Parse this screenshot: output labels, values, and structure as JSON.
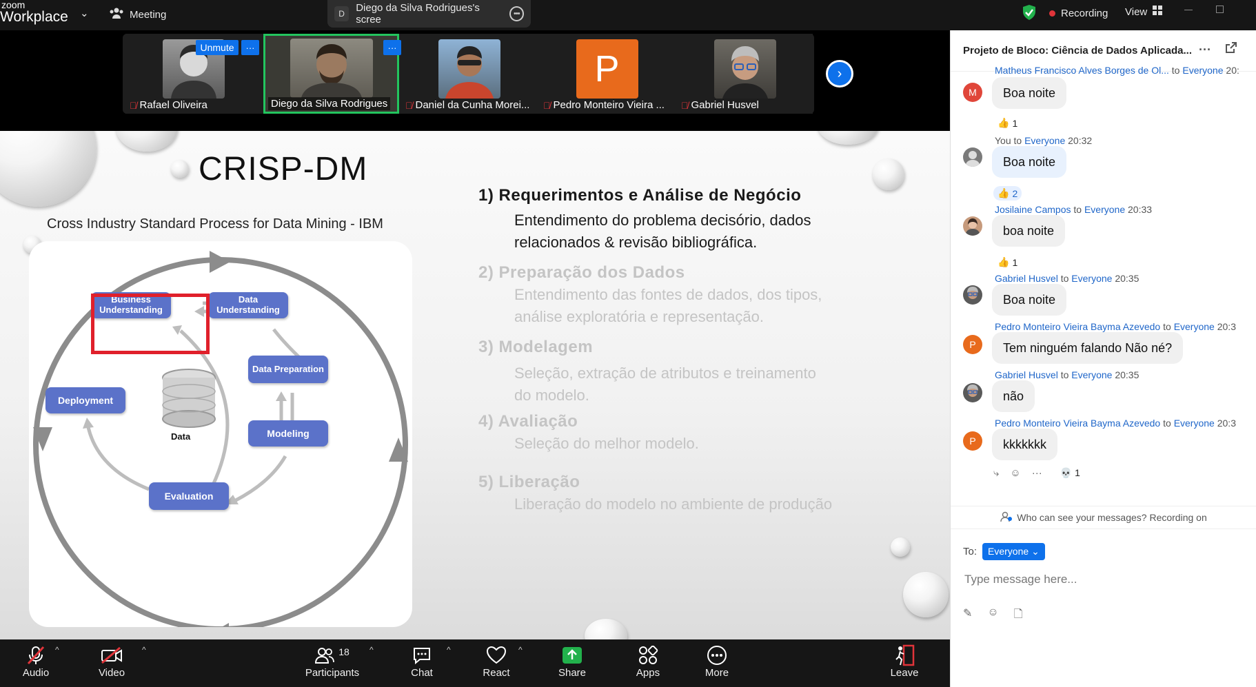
{
  "topbar": {
    "logo_top": "zoom",
    "logo_bottom": "Workplace",
    "meeting_label": "Meeting",
    "share_badge": "D",
    "share_title": "Diego da Silva Rodrigues's scree",
    "recording_label": "Recording",
    "view_label": "View"
  },
  "strip": {
    "unmute_label": "Unmute",
    "participants": [
      {
        "name": "Rafael Oliveira",
        "muted": true
      },
      {
        "name": "Diego da Silva Rodrigues",
        "muted": false,
        "active": true
      },
      {
        "name": "Daniel da Cunha Morei...",
        "muted": true
      },
      {
        "name": "Pedro Monteiro Vieira ...",
        "muted": true,
        "avatar_letter": "P"
      },
      {
        "name": "Gabriel Husvel",
        "muted": true
      }
    ]
  },
  "slide": {
    "title": "CRISP-DM",
    "subtitle": "Cross Industry Standard Process for Data Mining - IBM",
    "diagram": {
      "business": "Business Understanding",
      "data_understanding": "Data Understanding",
      "data_preparation": "Data Preparation",
      "modeling": "Modeling",
      "evaluation": "Evaluation",
      "deployment": "Deployment",
      "data": "Data"
    },
    "steps": [
      {
        "heading": "1) Requerimentos e Análise de Negócio",
        "line1": "Entendimento do problema decisório, dados",
        "line2": "relacionados & revisão bibliográfica."
      },
      {
        "heading": "2) Preparação dos Dados",
        "line1": "Entendimento das fontes de dados, dos tipos,",
        "line2": "análise exploratória e representação."
      },
      {
        "heading": "3) Modelagem",
        "line1": "Seleção, extração de atributos e treinamento",
        "line2": "do modelo."
      },
      {
        "heading": "4) Avaliação",
        "line1": "Seleção do melhor modelo.",
        "line2": ""
      },
      {
        "heading": "5) Liberação",
        "line1": "Liberação do modelo no ambiente de produção",
        "line2": ""
      }
    ]
  },
  "bottombar": {
    "audio": "Audio",
    "video": "Video",
    "participants": "Participants",
    "participants_count": "18",
    "chat": "Chat",
    "react": "React",
    "share": "Share",
    "apps": "Apps",
    "more": "More",
    "leave": "Leave"
  },
  "chat": {
    "title": "Projeto de Bloco: Ciência de Dados Aplicada...",
    "to_word": "to",
    "messages": [
      {
        "sender": "Matheus Francisco Alves Borges de Ol...",
        "to": "Everyone",
        "time": "20:",
        "text": "Boa noite",
        "avatar": "M",
        "reaction": "1"
      },
      {
        "sender": "You",
        "to": "Everyone",
        "time": "20:32",
        "text": "Boa noite",
        "reaction": "2"
      },
      {
        "sender": "Josilaine Campos",
        "to": "Everyone",
        "time": "20:33",
        "text": "boa noite",
        "reaction": "1"
      },
      {
        "sender": "Gabriel Husvel",
        "to": "Everyone",
        "time": "20:35",
        "text": "Boa noite"
      },
      {
        "sender": "Pedro Monteiro Vieira Bayma Azevedo",
        "to": "Everyone",
        "time": "20:3",
        "text": "Tem ninguém falando Não né?",
        "avatar": "P"
      },
      {
        "sender": "Gabriel Husvel",
        "to": "Everyone",
        "time": "20:35",
        "text": "não"
      },
      {
        "sender": "Pedro Monteiro Vieira Bayma Azevedo",
        "to": "Everyone",
        "time": "20:3",
        "text": "kkkkkkk",
        "avatar": "P",
        "reaction": "1"
      }
    ],
    "notice": "Who can see your messages? Recording on",
    "to_label": "To:",
    "recipient": "Everyone",
    "input_placeholder": "Type message here..."
  },
  "colors": {
    "accent": "#0e71eb",
    "mute_red": "#e0343a",
    "active_green": "#23c55e",
    "box_blue": "#5b72c9",
    "highlight_red": "#e0202b"
  }
}
